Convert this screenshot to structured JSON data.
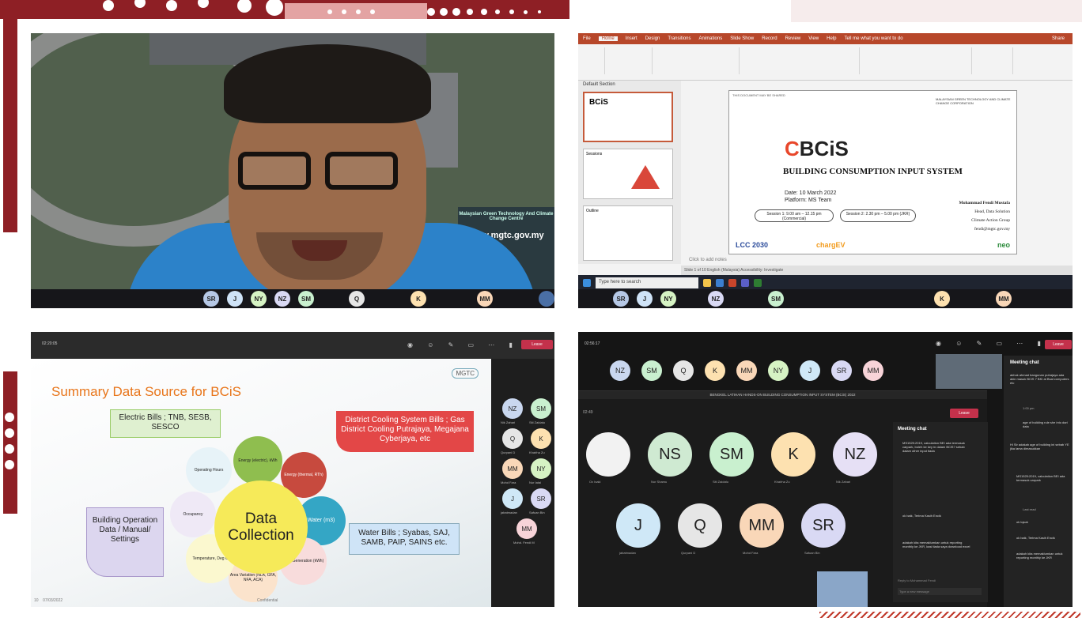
{
  "panel1": {
    "banner": {
      "org": "Malaysian Green Technology And Climate Change Centre",
      "url": "www.mgtc.gov.my"
    },
    "participants": [
      "SR",
      "J",
      "NY",
      "NZ",
      "SM",
      "Q",
      "K",
      "MM"
    ]
  },
  "panel2": {
    "ribbon_tabs": [
      "File",
      "Home",
      "Insert",
      "Design",
      "Transitions",
      "Animations",
      "Slide Show",
      "Record",
      "Review",
      "View",
      "Help",
      "Tell me what you want to do"
    ],
    "share": "Share",
    "section": "Default Section",
    "thumb_titles": [
      "Sessions",
      "Outline"
    ],
    "slide": {
      "top_note": "THIS DOCUMENT MAY BE SHARED",
      "corp": "MALAYSIAN GREEN TECHNOLOGY AND CLIMATE CHANGE CORPORATION",
      "logo": "BCiS",
      "title": "BUILDING CONSUMPTION INPUT SYSTEM",
      "date": "Date: 10 March 2022",
      "platform": "Platform: MS Team",
      "session1": "Session 1: 9.00 am – 12.15 pm (Commercial)",
      "session2": "Session 2: 2.30 pm – 5.00 pm (JKR)",
      "presenter": [
        "Mohammad Fendi Mustafa",
        "Head, Data Solution",
        "Climate Action Group",
        "fendi@mgtc.gov.my"
      ],
      "sponsors": [
        "LCC 2030",
        "chargEV",
        "neo"
      ]
    },
    "notes": "Click to add notes",
    "status": "Slide 1 of 10   English (Malaysia)   Accessibility: Investigate",
    "search": "Type here to search",
    "participants": [
      "SR",
      "J",
      "NY",
      "NZ",
      "SM",
      "K",
      "MM"
    ]
  },
  "panel3": {
    "time": "02:20:05",
    "leave": "Leave",
    "slide_title": "Summary Data Source for BCiS",
    "logo": "MGTC",
    "electric": "Electric Bills ; TNB, SESB, SESCO",
    "district": "District Cooling System Bills ; Gas District Cooling Putrajaya, Megajana Cyberjaya, etc",
    "building": "Building Operation Data / Manual/ Settings",
    "water_bills": "Water Bills ; Syabas, SAJ, SAMB, PAIP, SAINS etc.",
    "centre": "Data Collection",
    "circles": {
      "energy_elec": "Energy (electric), kWh",
      "energy_therm": "Energy (thermal, RTh)",
      "water": "Water (m3)",
      "solar": "Solar Generation (kWh)",
      "area": "Area Variation (NLA, GFA, NFA, ACA)",
      "temp": "Temperature, Deg C",
      "occupancy": "Occupancy",
      "hours": "Operating Hours"
    },
    "footer_num": "10",
    "footer_date": "07/03/2022",
    "footer_conf": "Confidential",
    "gallery": [
      {
        "i": "NZ",
        "n": "Nik Zahari"
      },
      {
        "i": "SM",
        "n": "Siti Zaidatu"
      },
      {
        "i": "Q",
        "n": "Qurpani D"
      },
      {
        "i": "K",
        "n": "Khairha Zu"
      },
      {
        "i": "MM",
        "n": "Mohd Fara"
      },
      {
        "i": "NY",
        "n": "Nur Iatal"
      },
      {
        "i": "J",
        "n": "jabatmadan"
      },
      {
        "i": "SR",
        "n": "Safuan Bin"
      },
      {
        "i": "MM",
        "n": "Mohd. Fendi M"
      }
    ]
  },
  "panel4": {
    "time": "02:56:17",
    "leave": "Leave",
    "top_row": [
      {
        "i": "NZ",
        "n": "Nik Zahari"
      },
      {
        "i": "SM",
        "n": "Siti Zaidatu"
      },
      {
        "i": "Q",
        "n": "Qurpani D"
      },
      {
        "i": "K",
        "n": "Khairha Zu"
      },
      {
        "i": "MM",
        "n": "Mohd Fara"
      },
      {
        "i": "NY",
        "n": "Nur Iatal"
      },
      {
        "i": "J",
        "n": "jabatmadan"
      },
      {
        "i": "SR",
        "n": "Safuan Bin"
      },
      {
        "i": "MM",
        "n": "Mohd. Fendi M"
      }
    ],
    "inner_title": "BENGKEL LATIHAN HANDS-ON BUILDING CONSUMPTION INPUT SYSTEM (BCiS) 2022",
    "inner_time": "02:49",
    "inner_leave": "Leave",
    "grid": [
      {
        "i": "",
        "n": "Ox Isaki"
      },
      {
        "i": "NS",
        "n": "Nor Shamu"
      },
      {
        "i": "SM",
        "n": "Siti Zaidatu"
      },
      {
        "i": "K",
        "n": "Khairha Zu"
      },
      {
        "i": "NZ",
        "n": "Nik Zahari"
      },
      {
        "i": "J",
        "n": "jabatmadan"
      },
      {
        "i": "Q",
        "n": "Qurpani D"
      },
      {
        "i": "MM",
        "n": "Mohd Fara"
      },
      {
        "i": "SR",
        "n": "Safuan Bin"
      }
    ],
    "chat_title": "Meeting chat",
    "chat_msgs": [
      "MS1525:2019, calculation BEI ada termasuk carpark, boleh ke key in dalam BCiS? sebab dalam other input tiada",
      "ok baik, Terima Kasih Encik",
      "adakah kita memaklumkan untuk reporting monthly ke JKR, kasi tiada saya download excel"
    ],
    "chat_input": "Type a new message",
    "reply_label": "Reply to Mohammad Fendi",
    "right_msgs": [
      "akhuk ahmad bangunan putrajaya ada akin masuk BCiS 7 BKI at Bsal computers etc",
      "1:00 pm",
      "age of building rule she into dari data",
      "Hi Sir adakah age of building ini sebab YE jika lama dimasukkan",
      "MS1525:2019, calculation BEI ada termasuk carpark",
      "Last read",
      "ok tqsuk",
      "ok baik, Terima Kasih Encik",
      "adakah kita memaklumkan untuk reporting monthly ke JKR"
    ]
  },
  "colors": {
    "brand_dark": "#8e1f25",
    "brand_pink": "#e3a3a3",
    "leave_red": "#c4314b",
    "ppt_orange": "#b7472a",
    "slide_title_orange": "#e8751a"
  },
  "icons": [
    "search-icon",
    "camera-icon",
    "mic-icon",
    "share-icon",
    "chat-icon",
    "people-icon",
    "close-icon"
  ]
}
